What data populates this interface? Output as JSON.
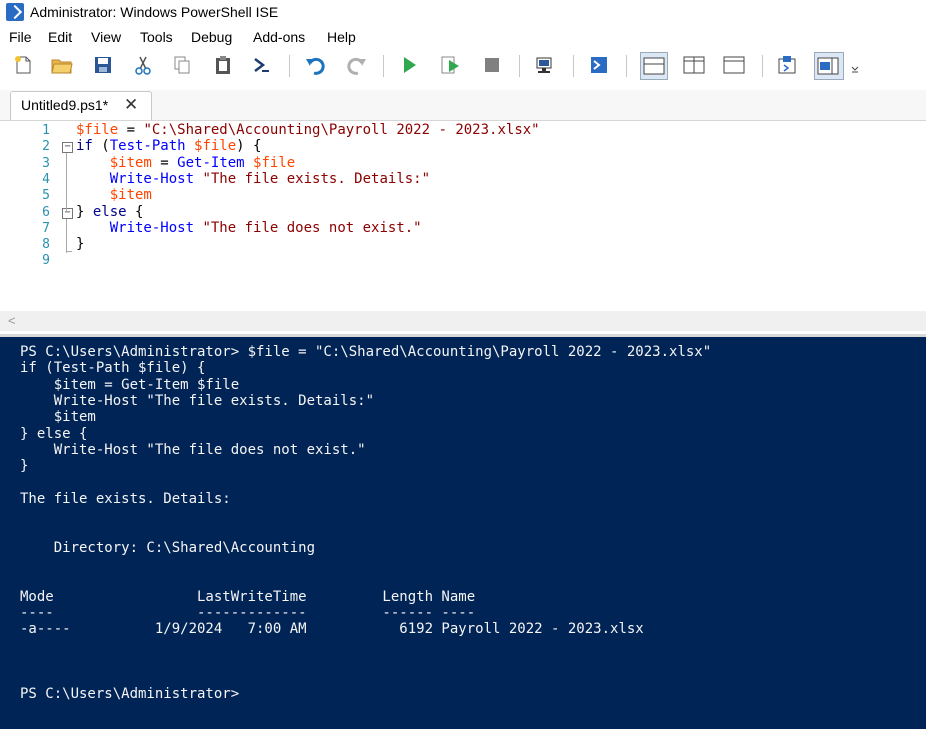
{
  "window": {
    "title": "Administrator: Windows PowerShell ISE"
  },
  "menu": [
    "File",
    "Edit",
    "View",
    "Tools",
    "Debug",
    "Add-ons",
    "Help"
  ],
  "toolbar": {
    "icons": [
      "new-file-icon",
      "open-folder-icon",
      "save-icon",
      "cut-icon",
      "copy-icon",
      "paste-icon",
      "clear-console-icon",
      "undo-icon",
      "redo-icon",
      "run-script-icon",
      "run-selection-icon",
      "stop-icon",
      "remote-powershell-icon",
      "start-powershell-icon",
      "show-script-pane-top-icon",
      "show-script-pane-right-icon",
      "show-script-pane-maximized-icon",
      "show-command-window-icon",
      "show-command-addon-icon"
    ]
  },
  "tab": {
    "label": "Untitled9.ps1*",
    "close": "✕"
  },
  "editor": {
    "line_numbers": [
      "1",
      "2",
      "3",
      "4",
      "5",
      "6",
      "7",
      "8",
      "9"
    ],
    "fold_markers": [
      "−",
      "−"
    ],
    "scroll_arrow": "<",
    "lines": [
      [
        {
          "text": "$file",
          "cls": "v"
        },
        {
          "text": " = ",
          "cls": "t"
        },
        {
          "text": "\"C:\\Shared\\Accounting\\Payroll 2022 - 2023.xlsx\"",
          "cls": "s"
        }
      ],
      [
        {
          "text": "if",
          "cls": "k"
        },
        {
          "text": " (",
          "cls": "t"
        },
        {
          "text": "Test-Path",
          "cls": "c"
        },
        {
          "text": " ",
          "cls": "t"
        },
        {
          "text": "$file",
          "cls": "v"
        },
        {
          "text": ") {",
          "cls": "t"
        }
      ],
      [
        {
          "text": "    ",
          "cls": "t"
        },
        {
          "text": "$item",
          "cls": "v"
        },
        {
          "text": " = ",
          "cls": "t"
        },
        {
          "text": "Get-Item",
          "cls": "c"
        },
        {
          "text": " ",
          "cls": "t"
        },
        {
          "text": "$file",
          "cls": "v"
        }
      ],
      [
        {
          "text": "    ",
          "cls": "t"
        },
        {
          "text": "Write-Host",
          "cls": "c"
        },
        {
          "text": " ",
          "cls": "t"
        },
        {
          "text": "\"The file exists. Details:\"",
          "cls": "s"
        }
      ],
      [
        {
          "text": "    ",
          "cls": "t"
        },
        {
          "text": "$item",
          "cls": "v"
        }
      ],
      [
        {
          "text": "} ",
          "cls": "t"
        },
        {
          "text": "else",
          "cls": "k"
        },
        {
          "text": " {",
          "cls": "t"
        }
      ],
      [
        {
          "text": "    ",
          "cls": "t"
        },
        {
          "text": "Write-Host",
          "cls": "c"
        },
        {
          "text": " ",
          "cls": "t"
        },
        {
          "text": "\"The file does not exist.\"",
          "cls": "s"
        }
      ],
      [
        {
          "text": "}",
          "cls": "t"
        }
      ],
      []
    ]
  },
  "console": {
    "lines": [
      "PS C:\\Users\\Administrator> $file = \"C:\\Shared\\Accounting\\Payroll 2022 - 2023.xlsx\"",
      "if (Test-Path $file) {",
      "    $item = Get-Item $file",
      "    Write-Host \"The file exists. Details:\"",
      "    $item",
      "} else {",
      "    Write-Host \"The file does not exist.\"",
      "}",
      "",
      "The file exists. Details:",
      "",
      "",
      "    Directory: C:\\Shared\\Accounting",
      "",
      "",
      "Mode                 LastWriteTime         Length Name",
      "----                 -------------         ------ ----",
      "-a----          1/9/2024   7:00 AM           6192 Payroll 2022 - 2023.xlsx",
      "",
      "",
      "",
      "PS C:\\Users\\Administrator>"
    ]
  }
}
